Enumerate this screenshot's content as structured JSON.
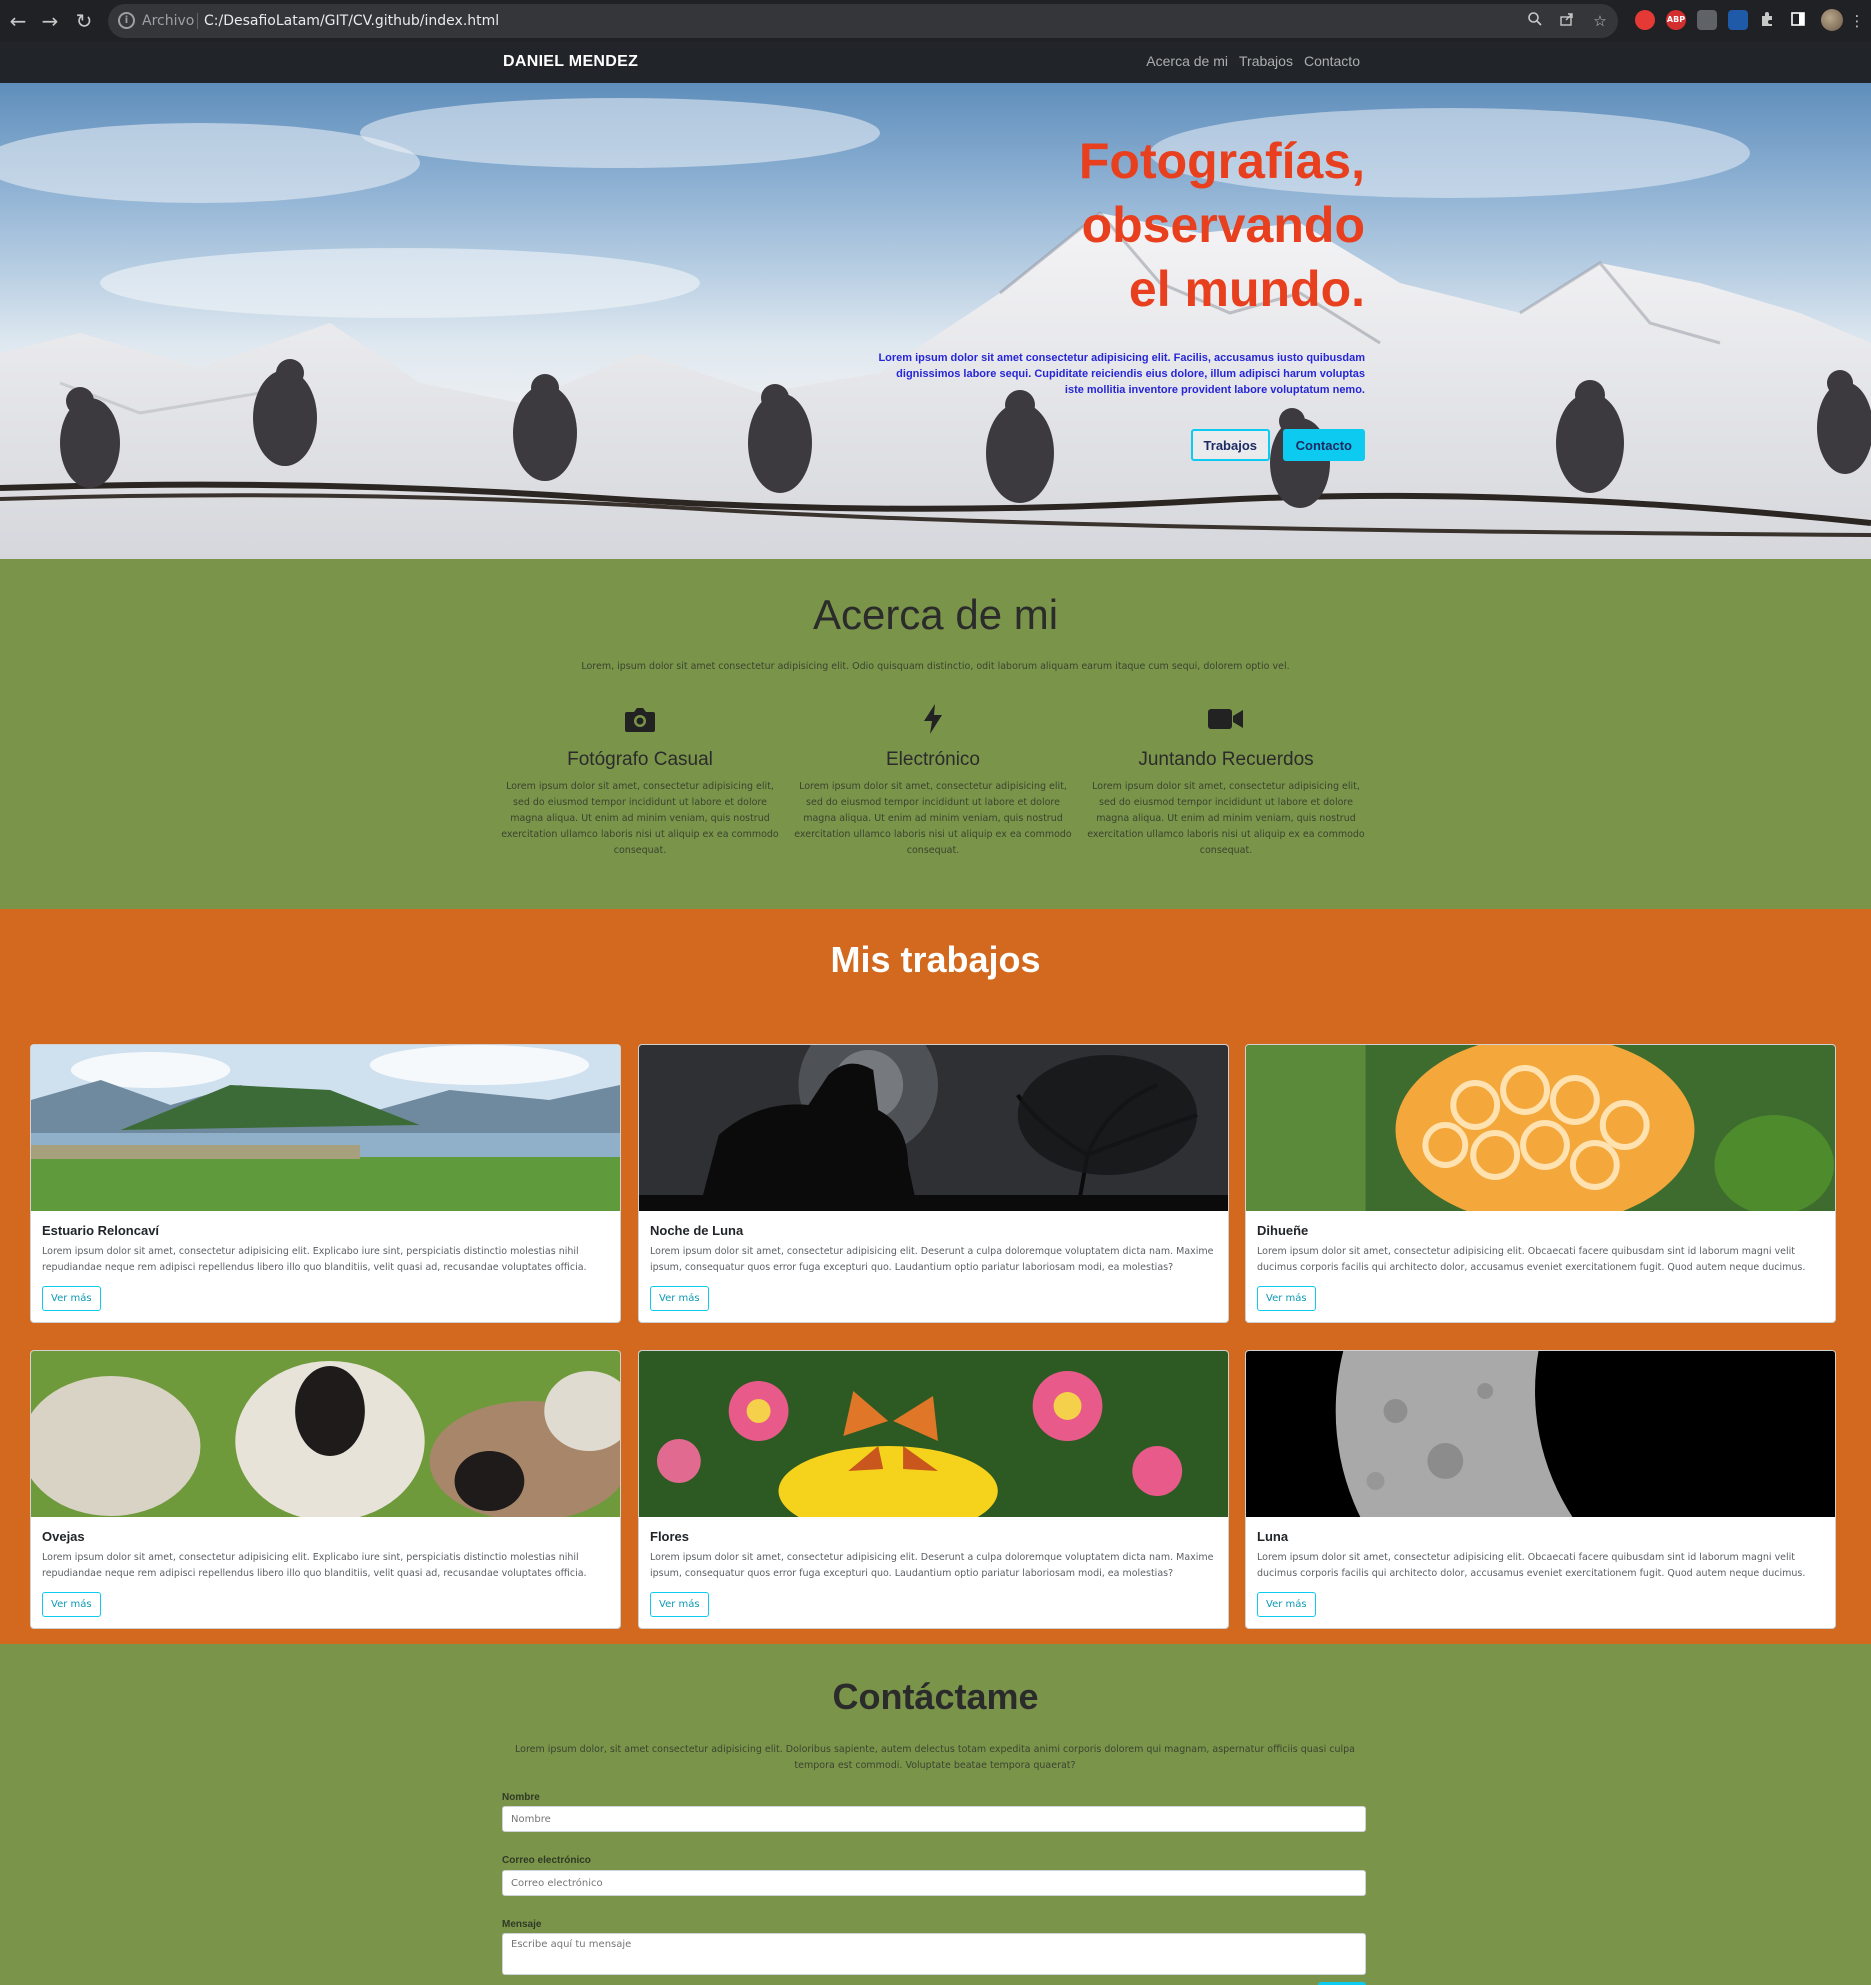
{
  "browser": {
    "scheme_label": "Archivo",
    "url": "C:/DesafioLatam/GIT/CV.github/index.html",
    "back_glyph": "←",
    "forward_glyph": "→",
    "reload_glyph": "↻",
    "extensions": [
      {
        "name": "red-extension-icon",
        "label": "",
        "color": "#e53935"
      },
      {
        "name": "adblock-icon",
        "label": "ABP",
        "color": "#d32f2f"
      },
      {
        "name": "window-extension-icon",
        "label": "",
        "color": "#5f6368"
      },
      {
        "name": "blue-extension-icon",
        "label": "",
        "color": "#1e5aa8"
      }
    ]
  },
  "nav": {
    "brand": "DANIEL MENDEZ",
    "links": [
      "Acerca de mi",
      "Trabajos",
      "Contacto"
    ]
  },
  "hero": {
    "title": "Fotografías,\nobservando\nel mundo.",
    "text": "Lorem ipsum dolor sit amet consectetur adipisicing elit. Facilis, accusamus iusto quibusdam dignissimos labore sequi. Cupiditate reiciendis eius dolore, illum adipisci harum voluptas iste mollitia inventore provident labore voluptatum nemo.",
    "btn_works": "Trabajos",
    "btn_contact": "Contacto",
    "title_color": "#e8401e",
    "text_color": "#2626d8"
  },
  "about": {
    "title": "Acerca de mi",
    "intro": "Lorem, ipsum dolor sit amet consectetur adipisicing elit. Odio quisquam distinctio, odit laborum aliquam earum itaque cum sequi, dolorem optio vel.",
    "features": [
      {
        "icon": "camera-icon",
        "title": "Fotógrafo Casual",
        "text": "Lorem ipsum dolor sit amet, consectetur adipisicing elit, sed do eiusmod tempor incididunt ut labore et dolore magna aliqua. Ut enim ad minim veniam, quis nostrud exercitation ullamco laboris nisi ut aliquip ex ea commodo consequat."
      },
      {
        "icon": "lightning-icon",
        "title": "Electrónico",
        "text": "Lorem ipsum dolor sit amet, consectetur adipisicing elit, sed do eiusmod tempor incididunt ut labore et dolore magna aliqua. Ut enim ad minim veniam, quis nostrud exercitation ullamco laboris nisi ut aliquip ex ea commodo consequat."
      },
      {
        "icon": "video-camera-icon",
        "title": "Juntando Recuerdos",
        "text": "Lorem ipsum dolor sit amet, consectetur adipisicing elit, sed do eiusmod tempor incididunt ut labore et dolore magna aliqua. Ut enim ad minim veniam, quis nostrud exercitation ullamco laboris nisi ut aliquip ex ea commodo consequat."
      }
    ],
    "bg_color": "#7a944a"
  },
  "works": {
    "title": "Mis trabajos",
    "bg_color": "#d2691e",
    "cards": [
      {
        "title": "Estuario Reloncaví",
        "image": "lake-mountains-image",
        "text": "Lorem ipsum dolor sit amet, consectetur adipisicing elit. Explicabo iure sint, perspiciatis distinctio molestias nihil repudiandae neque rem adipisci repellendus libero illo quo blanditiis, velit quasi ad, recusandae voluptates officia.",
        "button": "Ver más"
      },
      {
        "title": "Noche de Luna",
        "image": "night-silhouette-image",
        "text": "Lorem ipsum dolor sit amet, consectetur adipisicing elit. Deserunt a culpa doloremque voluptatem dicta nam. Maxime ipsum, consequatur quos error fuga excepturi quo. Laudantium optio pariatur laboriosam modi, ea molestias?",
        "button": "Ver más"
      },
      {
        "title": "Dihueñe",
        "image": "mushroom-image",
        "text": "Lorem ipsum dolor sit amet, consectetur adipisicing elit. Obcaecati facere quibusdam sint id laborum magni velit ducimus corporis facilis qui architecto dolor, accusamus eveniet exercitationem fugit. Quod autem neque ducimus.",
        "button": "Ver más"
      },
      {
        "title": "Ovejas",
        "image": "sheep-image",
        "text": "Lorem ipsum dolor sit amet, consectetur adipisicing elit. Explicabo iure sint, perspiciatis distinctio molestias nihil repudiandae neque rem adipisci repellendus libero illo quo blanditiis, velit quasi ad, recusandae voluptates officia.",
        "button": "Ver más"
      },
      {
        "title": "Flores",
        "image": "flowers-butterfly-image",
        "text": "Lorem ipsum dolor sit amet, consectetur adipisicing elit. Deserunt a culpa doloremque voluptatem dicta nam. Maxime ipsum, consequatur quos error fuga excepturi quo. Laudantium optio pariatur laboriosam modi, ea molestias?",
        "button": "Ver más"
      },
      {
        "title": "Luna",
        "image": "moon-image",
        "text": "Lorem ipsum dolor sit amet, consectetur adipisicing elit. Obcaecati facere quibusdam sint id laborum magni velit ducimus corporis facilis qui architecto dolor, accusamus eveniet exercitationem fugit. Quod autem neque ducimus.",
        "button": "Ver más"
      }
    ]
  },
  "contact": {
    "title": "Contáctame",
    "intro": "Lorem ipsum dolor, sit amet consectetur adipisicing elit. Doloribus sapiente, autem delectus totam expedita animi corporis dolorem qui magnam, aspernatur officiis quasi culpa tempora est commodi. Voluptate beatae tempora quaerat?",
    "name_label": "Nombre",
    "name_placeholder": "Nombre",
    "email_label": "Correo electrónico",
    "email_placeholder": "Correo electrónico",
    "message_label": "Mensaje",
    "message_placeholder": "Escribe aquí tu mensaje"
  }
}
